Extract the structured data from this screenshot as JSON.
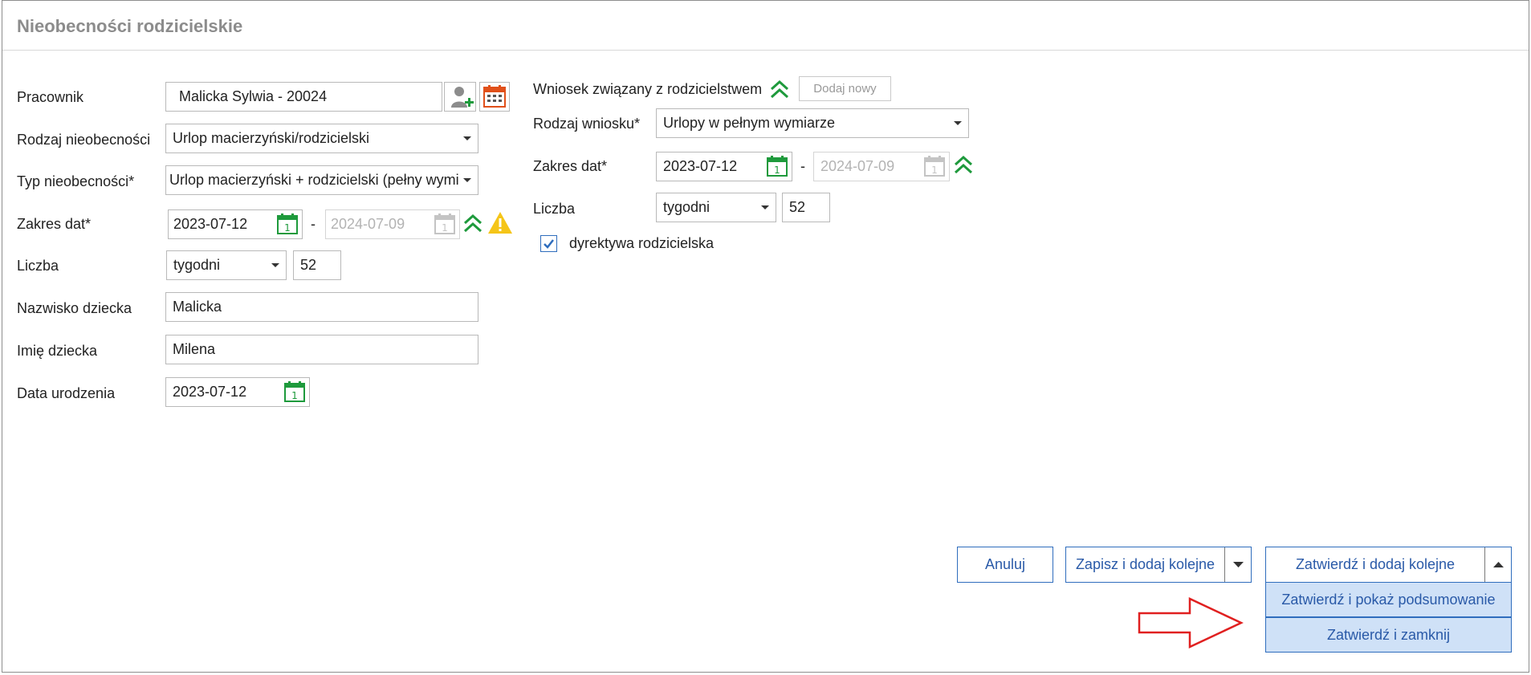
{
  "window": {
    "title": "Nieobecności rodzicielskie"
  },
  "left": {
    "employee": {
      "label": "Pracownik",
      "value": "Malicka Sylwia - 20024"
    },
    "absence_kind": {
      "label": "Rodzaj nieobecności",
      "value": "Urlop macierzyński/rodzicielski"
    },
    "absence_type": {
      "label": "Typ nieobecności*",
      "value": "Urlop macierzyński + rodzicielski (pełny wymi"
    },
    "date_range": {
      "label": "Zakres dat*",
      "from": "2023-07-12",
      "separator": "-",
      "to": "2024-07-09"
    },
    "count": {
      "label": "Liczba",
      "unit": "tygodni",
      "value": "52"
    },
    "child_surname": {
      "label": "Nazwisko dziecka",
      "value": "Malicka"
    },
    "child_name": {
      "label": "Imię dziecka",
      "value": "Milena"
    },
    "birth_date": {
      "label": "Data urodzenia",
      "value": "2023-07-12"
    }
  },
  "right": {
    "request_related": {
      "label": "Wniosek związany z rodzicielstwem",
      "add_new_label": "Dodaj nowy"
    },
    "request_kind": {
      "label": "Rodzaj wniosku*",
      "value": "Urlopy w pełnym wymiarze"
    },
    "date_range": {
      "label": "Zakres dat*",
      "from": "2023-07-12",
      "separator": "-",
      "to": "2024-07-09"
    },
    "count": {
      "label": "Liczba",
      "unit": "tygodni",
      "value": "52"
    },
    "directive": {
      "label": "dyrektywa rodzicielska",
      "checked": true
    }
  },
  "footer": {
    "cancel_label": "Anuluj",
    "save_add_label": "Zapisz i dodaj kolejne",
    "confirm_add_label": "Zatwierdź i dodaj kolejne",
    "menu": [
      {
        "label": "Zatwierdź i pokaż podsumowanie"
      },
      {
        "label": "Zatwierdź i zamknij"
      }
    ]
  },
  "colors": {
    "accent_blue": "#2f6dbd",
    "menu_highlight": "#cfe1f7",
    "calendar_green": "#1e9a3c",
    "calendar_orange": "#e0501a",
    "warning_yellow": "#f5c518",
    "arrow_red": "#e02020"
  }
}
